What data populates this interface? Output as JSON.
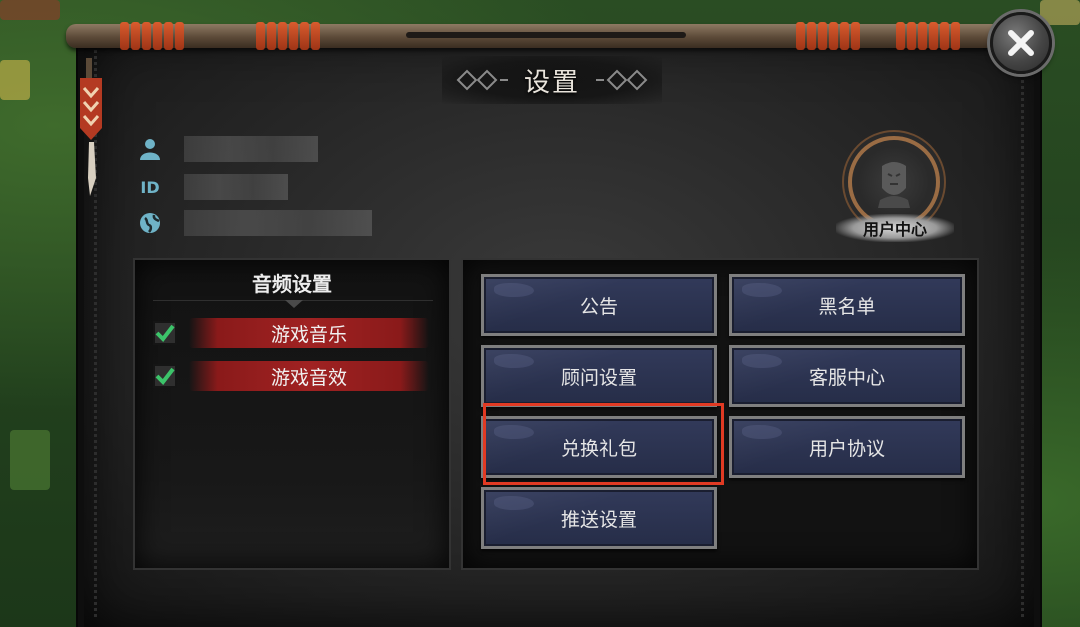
{
  "dialog": {
    "title": "设置",
    "close_icon": "close-icon"
  },
  "user_info": {
    "rows": [
      {
        "icon": "person-icon",
        "value": ""
      },
      {
        "icon": "id-icon",
        "label": "ID",
        "value": ""
      },
      {
        "icon": "globe-icon",
        "value": ""
      }
    ]
  },
  "user_center": {
    "label": "用户中心",
    "icon": "avatar-icon"
  },
  "audio": {
    "title": "音频设置",
    "items": [
      {
        "label": "游戏音乐",
        "checked": true
      },
      {
        "label": "游戏音效",
        "checked": true
      }
    ]
  },
  "menu": {
    "buttons": [
      {
        "label": "公告"
      },
      {
        "label": "黑名单"
      },
      {
        "label": "顾问设置"
      },
      {
        "label": "客服中心"
      },
      {
        "label": "兑换礼包",
        "highlighted": true
      },
      {
        "label": "用户协议"
      },
      {
        "label": "推送设置"
      }
    ]
  },
  "colors": {
    "panel": "#262626",
    "button_fill": "#2a3150",
    "highlight": "#e13a23",
    "audio_banner": "#a02222",
    "check": "#3cc46a"
  }
}
